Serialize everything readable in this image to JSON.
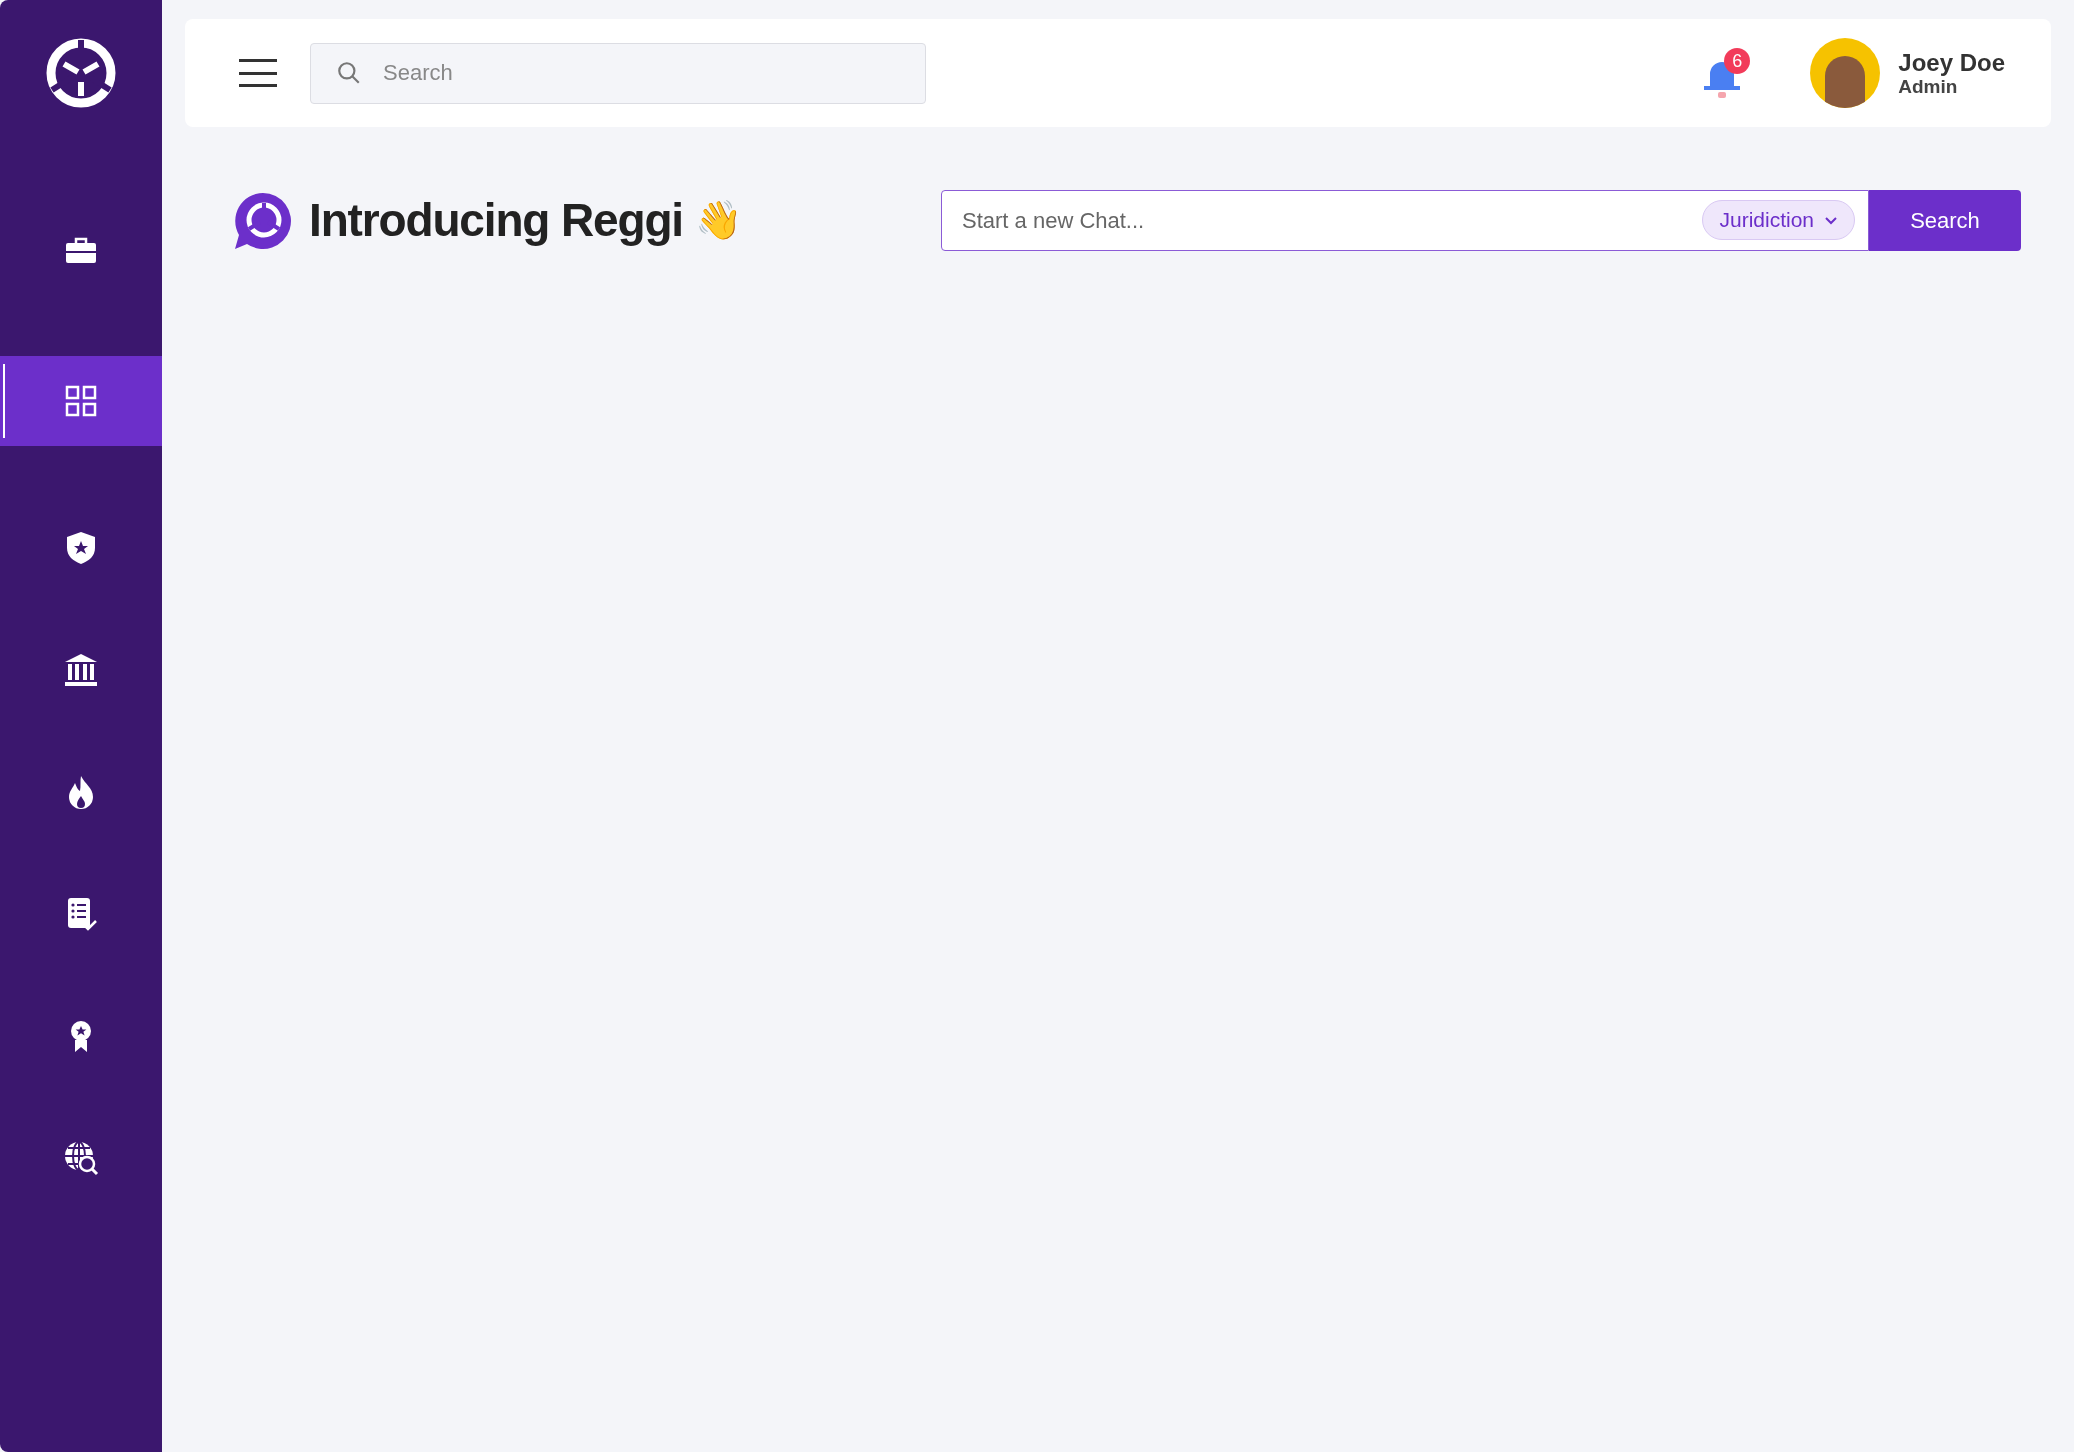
{
  "sidebar": {
    "items": [
      {
        "kind": "briefcase",
        "selected": false
      },
      {
        "kind": "grid",
        "selected": true
      },
      {
        "kind": "shield",
        "selected": false
      },
      {
        "kind": "bank",
        "selected": false
      },
      {
        "kind": "flame",
        "selected": false
      },
      {
        "kind": "checklist",
        "selected": false
      },
      {
        "kind": "award",
        "selected": false
      },
      {
        "kind": "globe",
        "selected": false
      }
    ]
  },
  "header": {
    "search": {
      "placeholder": "Search"
    },
    "notifications": {
      "count": "6"
    },
    "user": {
      "name": "Joey Doe",
      "role": "Admin"
    }
  },
  "main": {
    "title": "Introducing Reggi",
    "emoji": "👋",
    "chat": {
      "placeholder": "Start a new Chat...",
      "filter": "Juridiction",
      "button": "Search"
    }
  }
}
